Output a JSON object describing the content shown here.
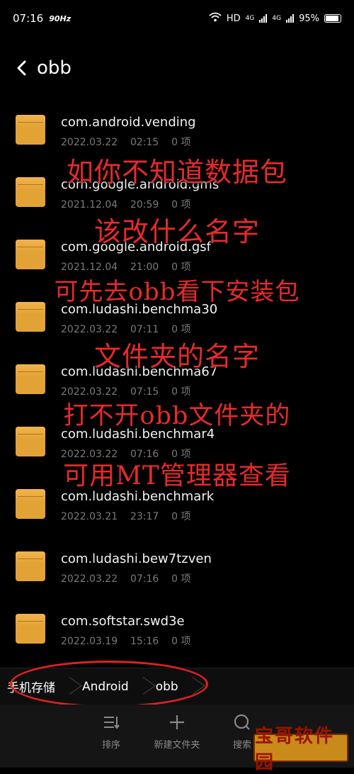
{
  "status": {
    "time": "07:16",
    "refresh": "90Hz",
    "network": "HD",
    "signal1": "4G",
    "signal2": "4G",
    "battery": "95%",
    "battery_level": 95
  },
  "header": {
    "title": "obb"
  },
  "folders": [
    {
      "name": "com.android.vending",
      "date": "2022.03.22",
      "time": "02:15",
      "count": "0 项"
    },
    {
      "name": "com.google.android.gms",
      "date": "2021.12.04",
      "time": "20:59",
      "count": "0 项"
    },
    {
      "name": "com.google.android.gsf",
      "date": "2021.12.04",
      "time": "21:00",
      "count": "0 项"
    },
    {
      "name": "com.ludashi.benchma30",
      "date": "2022.03.22",
      "time": "07:11",
      "count": "0 项"
    },
    {
      "name": "com.ludashi.benchma67",
      "date": "2022.03.22",
      "time": "07:15",
      "count": "0 项"
    },
    {
      "name": "com.ludashi.benchmar4",
      "date": "2022.03.22",
      "time": "07:16",
      "count": "0 项"
    },
    {
      "name": "com.ludashi.benchmark",
      "date": "2022.03.21",
      "time": "23:17",
      "count": "0 项"
    },
    {
      "name": "com.ludashi.bew7tzven",
      "date": "2022.03.22",
      "time": "07:16",
      "count": "0 项"
    },
    {
      "name": "com.softstar.swd3e",
      "date": "2022.03.19",
      "time": "15:16",
      "count": "0 项"
    }
  ],
  "overlay_text": [
    "如你不知道数据包",
    "该改什么名字",
    "可先去obb看下安装包",
    "文件夹的名字",
    "打不开obb文件夹的",
    "可用MT管理器查看"
  ],
  "breadcrumb": [
    "手机存储",
    "Android",
    "obb"
  ],
  "toolbar": {
    "sort_label": "排序",
    "new_folder_label": "新建文件夹",
    "search_label": "搜索"
  },
  "watermark": "宝哥软件园",
  "colors": {
    "folder": "#e3a235",
    "overlay": "#e82a2a",
    "highlight": "#e02020"
  }
}
